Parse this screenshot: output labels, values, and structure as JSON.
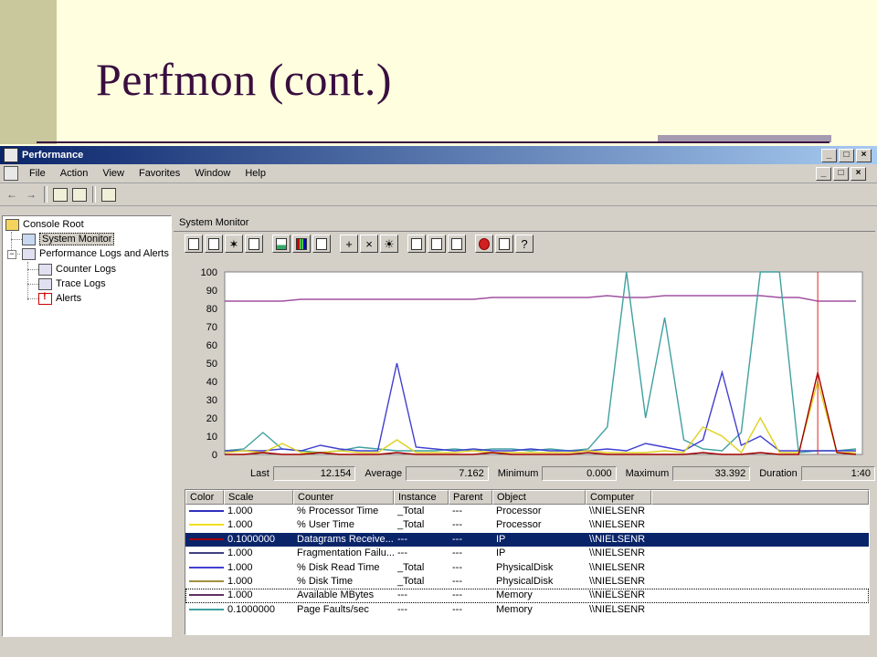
{
  "slide": {
    "title": "Perfmon (cont.)"
  },
  "window": {
    "title": "Performance",
    "menu": [
      "File",
      "Action",
      "View",
      "Favorites",
      "Window",
      "Help"
    ]
  },
  "tree": {
    "console_root": "Console Root",
    "system_monitor": "System Monitor",
    "perf_logs": "Performance Logs and Alerts",
    "counter_logs": "Counter Logs",
    "trace_logs": "Trace Logs",
    "alerts": "Alerts"
  },
  "monitor": {
    "header": "System Monitor"
  },
  "stats": {
    "last_label": "Last",
    "last_value": "12.154",
    "average_label": "Average",
    "average_value": "7.162",
    "minimum_label": "Minimum",
    "minimum_value": "0.000",
    "maximum_label": "Maximum",
    "maximum_value": "33.392",
    "duration_label": "Duration",
    "duration_value": "1:40"
  },
  "table": {
    "columns": [
      "Color",
      "Scale",
      "Counter",
      "Instance",
      "Parent",
      "Object",
      "Computer"
    ],
    "rows": [
      {
        "color": "#3030c0",
        "scale": "1.000",
        "counter": "% Processor Time",
        "instance": "_Total",
        "parent": "---",
        "object": "Processor",
        "computer": "\\\\NIELSENR"
      },
      {
        "color": "#f0e020",
        "scale": "1.000",
        "counter": "% User Time",
        "instance": "_Total",
        "parent": "---",
        "object": "Processor",
        "computer": "\\\\NIELSENR"
      },
      {
        "color": "#a00000",
        "scale": "0.1000000",
        "counter": "Datagrams Receive...",
        "instance": "---",
        "parent": "---",
        "object": "IP",
        "computer": "\\\\NIELSENR"
      },
      {
        "color": "#404080",
        "scale": "1.000",
        "counter": "Fragmentation Failu...",
        "instance": "---",
        "parent": "---",
        "object": "IP",
        "computer": "\\\\NIELSENR"
      },
      {
        "color": "#4040d0",
        "scale": "1.000",
        "counter": "% Disk Read Time",
        "instance": "_Total",
        "parent": "---",
        "object": "PhysicalDisk",
        "computer": "\\\\NIELSENR"
      },
      {
        "color": "#a09040",
        "scale": "1.000",
        "counter": "% Disk Time",
        "instance": "_Total",
        "parent": "---",
        "object": "PhysicalDisk",
        "computer": "\\\\NIELSENR"
      },
      {
        "color": "#603060",
        "scale": "1.000",
        "counter": "Available MBytes",
        "instance": "---",
        "parent": "---",
        "object": "Memory",
        "computer": "\\\\NIELSENR"
      },
      {
        "color": "#40a0a0",
        "scale": "0.1000000",
        "counter": "Page Faults/sec",
        "instance": "---",
        "parent": "---",
        "object": "Memory",
        "computer": "\\\\NIELSENR"
      }
    ],
    "selected_index": 2,
    "focused_index": 6
  },
  "chart_data": {
    "type": "line",
    "ylim": [
      0,
      100
    ],
    "yticks": [
      "100",
      "90",
      "80",
      "70",
      "60",
      "50",
      "40",
      "30",
      "20",
      "10",
      "0"
    ],
    "x": [
      0,
      3,
      6,
      9,
      12,
      15,
      18,
      21,
      24,
      27,
      30,
      33,
      36,
      39,
      42,
      45,
      48,
      51,
      54,
      57,
      60,
      63,
      66,
      69,
      72,
      75,
      78,
      81,
      84,
      87,
      90,
      93,
      96,
      99
    ],
    "series": [
      {
        "color": "#a050a0",
        "values": [
          84,
          84,
          84,
          84,
          85,
          85,
          85,
          85,
          85,
          85,
          85,
          85,
          85,
          85,
          86,
          86,
          86,
          86,
          86,
          86,
          87,
          86,
          86,
          87,
          87,
          87,
          87,
          87,
          87,
          86,
          86,
          84,
          84,
          84
        ]
      },
      {
        "color": "#40a0a0",
        "values": [
          2,
          3,
          12,
          3,
          2,
          1,
          2,
          4,
          3,
          2,
          2,
          2,
          3,
          2,
          3,
          3,
          2,
          3,
          2,
          3,
          15,
          100,
          20,
          75,
          8,
          3,
          2,
          12,
          100,
          100,
          1,
          2,
          2,
          3
        ]
      },
      {
        "color": "#4040d0",
        "values": [
          2,
          2,
          2,
          3,
          2,
          5,
          3,
          2,
          2,
          50,
          4,
          3,
          2,
          3,
          2,
          2,
          3,
          2,
          2,
          2,
          3,
          2,
          6,
          4,
          2,
          8,
          45,
          5,
          10,
          2,
          2,
          2,
          2,
          2
        ]
      },
      {
        "color": "#e0d020",
        "values": [
          1,
          2,
          1,
          6,
          1,
          1,
          2,
          1,
          1,
          8,
          1,
          1,
          1,
          2,
          1,
          1,
          1,
          1,
          1,
          2,
          1,
          1,
          1,
          2,
          1,
          15,
          10,
          1,
          20,
          1,
          1,
          40,
          1,
          1
        ]
      },
      {
        "color": "#a00000",
        "values": [
          0,
          0,
          1,
          0,
          0,
          1,
          0,
          0,
          0,
          1,
          0,
          0,
          0,
          0,
          1,
          0,
          0,
          0,
          0,
          1,
          0,
          0,
          0,
          0,
          0,
          1,
          0,
          0,
          1,
          0,
          0,
          45,
          1,
          0
        ]
      }
    ],
    "current_marker_x": 93
  }
}
